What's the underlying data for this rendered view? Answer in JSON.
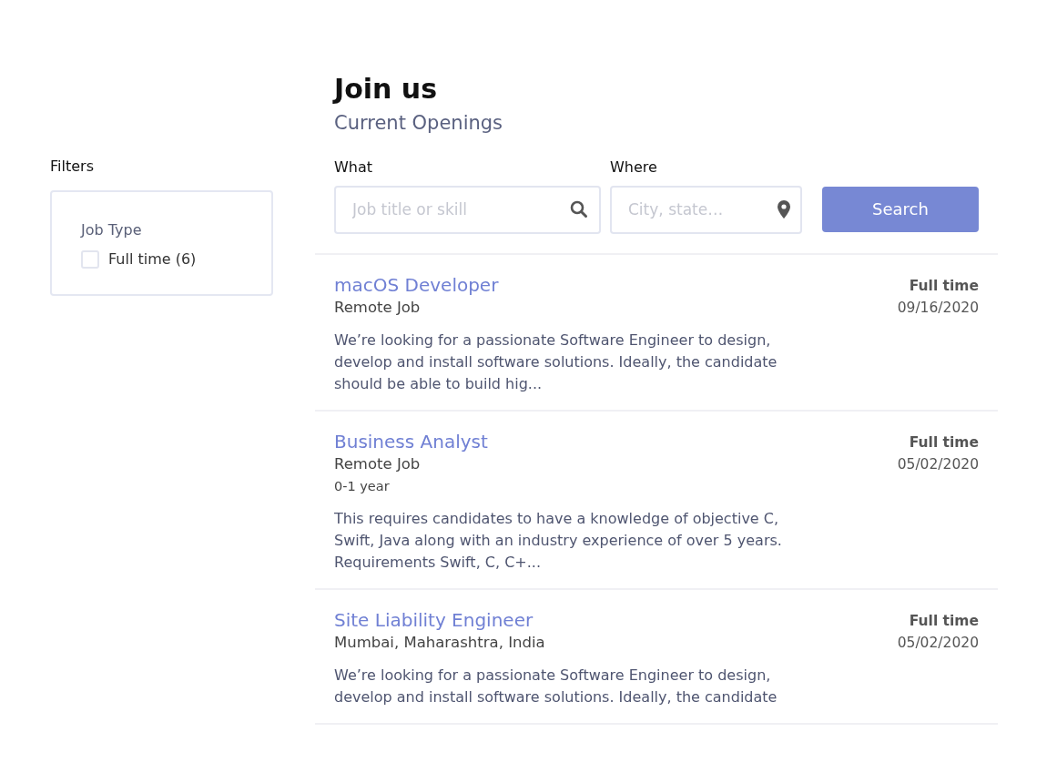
{
  "header": {
    "title": "Join us",
    "subtitle": "Current Openings"
  },
  "filters": {
    "title": "Filters",
    "groups": [
      {
        "title": "Job Type",
        "options": [
          {
            "label": "Full time (6)",
            "checked": false
          }
        ]
      }
    ]
  },
  "search": {
    "what": {
      "label": "What",
      "placeholder": "Job title or skill"
    },
    "where": {
      "label": "Where",
      "placeholder": "City, state…"
    },
    "button": "Search"
  },
  "jobs": [
    {
      "title": "macOS Developer",
      "location": "Remote Job",
      "description": "We’re looking for a passionate Software Engineer to design, develop and install software solutions. Ideally, the candidate should be able to build hig...",
      "type": "Full time",
      "date": "09/16/2020"
    },
    {
      "title": "Business Analyst",
      "location": "Remote Job",
      "experience": "0-1 year",
      "description": "This requires candidates to have a knowledge of objective C, Swift, Java along with an industry experience of over 5 years. Requirements Swift, C, C+...",
      "type": "Full time",
      "date": "05/02/2020"
    },
    {
      "title": "Site Liability Engineer",
      "location": "Mumbai, Maharashtra, India",
      "description": "We’re looking for a passionate Software Engineer to design, develop and install software solutions. Ideally, the candidate",
      "type": "Full time",
      "date": "05/02/2020"
    }
  ]
}
